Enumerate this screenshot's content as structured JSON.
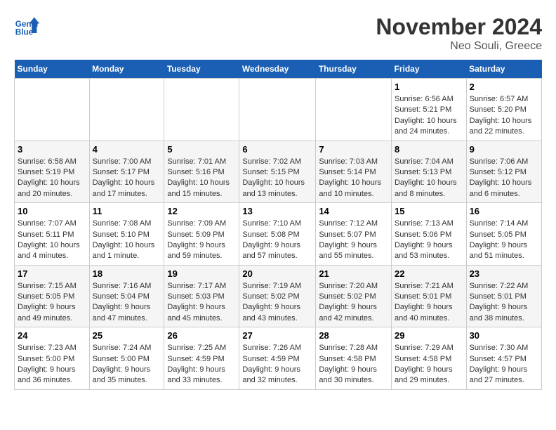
{
  "header": {
    "logo_text_general": "General",
    "logo_text_blue": "Blue",
    "month_year": "November 2024",
    "location": "Neo Souli, Greece"
  },
  "weekdays": [
    "Sunday",
    "Monday",
    "Tuesday",
    "Wednesday",
    "Thursday",
    "Friday",
    "Saturday"
  ],
  "weeks": [
    [
      {
        "day": "",
        "info": ""
      },
      {
        "day": "",
        "info": ""
      },
      {
        "day": "",
        "info": ""
      },
      {
        "day": "",
        "info": ""
      },
      {
        "day": "",
        "info": ""
      },
      {
        "day": "1",
        "info": "Sunrise: 6:56 AM\nSunset: 5:21 PM\nDaylight: 10 hours and 24 minutes."
      },
      {
        "day": "2",
        "info": "Sunrise: 6:57 AM\nSunset: 5:20 PM\nDaylight: 10 hours and 22 minutes."
      }
    ],
    [
      {
        "day": "3",
        "info": "Sunrise: 6:58 AM\nSunset: 5:19 PM\nDaylight: 10 hours and 20 minutes."
      },
      {
        "day": "4",
        "info": "Sunrise: 7:00 AM\nSunset: 5:17 PM\nDaylight: 10 hours and 17 minutes."
      },
      {
        "day": "5",
        "info": "Sunrise: 7:01 AM\nSunset: 5:16 PM\nDaylight: 10 hours and 15 minutes."
      },
      {
        "day": "6",
        "info": "Sunrise: 7:02 AM\nSunset: 5:15 PM\nDaylight: 10 hours and 13 minutes."
      },
      {
        "day": "7",
        "info": "Sunrise: 7:03 AM\nSunset: 5:14 PM\nDaylight: 10 hours and 10 minutes."
      },
      {
        "day": "8",
        "info": "Sunrise: 7:04 AM\nSunset: 5:13 PM\nDaylight: 10 hours and 8 minutes."
      },
      {
        "day": "9",
        "info": "Sunrise: 7:06 AM\nSunset: 5:12 PM\nDaylight: 10 hours and 6 minutes."
      }
    ],
    [
      {
        "day": "10",
        "info": "Sunrise: 7:07 AM\nSunset: 5:11 PM\nDaylight: 10 hours and 4 minutes."
      },
      {
        "day": "11",
        "info": "Sunrise: 7:08 AM\nSunset: 5:10 PM\nDaylight: 10 hours and 1 minute."
      },
      {
        "day": "12",
        "info": "Sunrise: 7:09 AM\nSunset: 5:09 PM\nDaylight: 9 hours and 59 minutes."
      },
      {
        "day": "13",
        "info": "Sunrise: 7:10 AM\nSunset: 5:08 PM\nDaylight: 9 hours and 57 minutes."
      },
      {
        "day": "14",
        "info": "Sunrise: 7:12 AM\nSunset: 5:07 PM\nDaylight: 9 hours and 55 minutes."
      },
      {
        "day": "15",
        "info": "Sunrise: 7:13 AM\nSunset: 5:06 PM\nDaylight: 9 hours and 53 minutes."
      },
      {
        "day": "16",
        "info": "Sunrise: 7:14 AM\nSunset: 5:05 PM\nDaylight: 9 hours and 51 minutes."
      }
    ],
    [
      {
        "day": "17",
        "info": "Sunrise: 7:15 AM\nSunset: 5:05 PM\nDaylight: 9 hours and 49 minutes."
      },
      {
        "day": "18",
        "info": "Sunrise: 7:16 AM\nSunset: 5:04 PM\nDaylight: 9 hours and 47 minutes."
      },
      {
        "day": "19",
        "info": "Sunrise: 7:17 AM\nSunset: 5:03 PM\nDaylight: 9 hours and 45 minutes."
      },
      {
        "day": "20",
        "info": "Sunrise: 7:19 AM\nSunset: 5:02 PM\nDaylight: 9 hours and 43 minutes."
      },
      {
        "day": "21",
        "info": "Sunrise: 7:20 AM\nSunset: 5:02 PM\nDaylight: 9 hours and 42 minutes."
      },
      {
        "day": "22",
        "info": "Sunrise: 7:21 AM\nSunset: 5:01 PM\nDaylight: 9 hours and 40 minutes."
      },
      {
        "day": "23",
        "info": "Sunrise: 7:22 AM\nSunset: 5:01 PM\nDaylight: 9 hours and 38 minutes."
      }
    ],
    [
      {
        "day": "24",
        "info": "Sunrise: 7:23 AM\nSunset: 5:00 PM\nDaylight: 9 hours and 36 minutes."
      },
      {
        "day": "25",
        "info": "Sunrise: 7:24 AM\nSunset: 5:00 PM\nDaylight: 9 hours and 35 minutes."
      },
      {
        "day": "26",
        "info": "Sunrise: 7:25 AM\nSunset: 4:59 PM\nDaylight: 9 hours and 33 minutes."
      },
      {
        "day": "27",
        "info": "Sunrise: 7:26 AM\nSunset: 4:59 PM\nDaylight: 9 hours and 32 minutes."
      },
      {
        "day": "28",
        "info": "Sunrise: 7:28 AM\nSunset: 4:58 PM\nDaylight: 9 hours and 30 minutes."
      },
      {
        "day": "29",
        "info": "Sunrise: 7:29 AM\nSunset: 4:58 PM\nDaylight: 9 hours and 29 minutes."
      },
      {
        "day": "30",
        "info": "Sunrise: 7:30 AM\nSunset: 4:57 PM\nDaylight: 9 hours and 27 minutes."
      }
    ]
  ]
}
